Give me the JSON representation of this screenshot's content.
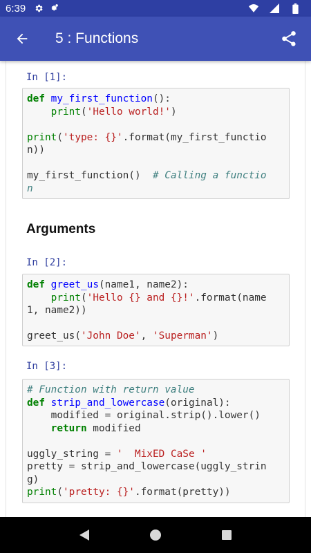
{
  "status_bar": {
    "time": "6:39",
    "icons": [
      "settings-icon",
      "settings-dot-icon",
      "wifi-icon",
      "signal-icon",
      "battery-icon"
    ]
  },
  "app_bar": {
    "title": "5 : Functions",
    "back_icon": "arrow-back-icon",
    "share_icon": "share-icon",
    "color": "#3f51b5",
    "status_color": "#2e3fa3"
  },
  "cells": [
    {
      "prompt": "In [1]:",
      "lines": [
        [
          [
            "kw",
            "def"
          ],
          [
            "t",
            " "
          ],
          [
            "fn",
            "my_first_function"
          ],
          [
            "t",
            "():"
          ]
        ],
        [
          [
            "t",
            "    "
          ],
          [
            "bi",
            "print"
          ],
          [
            "t",
            "("
          ],
          [
            "st",
            "'Hello world!'"
          ],
          [
            "t",
            ")"
          ]
        ],
        [
          [
            "t",
            ""
          ]
        ],
        [
          [
            "bi",
            "print"
          ],
          [
            "t",
            "("
          ],
          [
            "st",
            "'type: {}'"
          ],
          [
            "t",
            ".format(my_first_functio"
          ]
        ],
        [
          [
            "t",
            "n))"
          ]
        ],
        [
          [
            "t",
            ""
          ]
        ],
        [
          [
            "t",
            "my_first_function()  "
          ],
          [
            "cm",
            "# Calling a functio"
          ]
        ],
        [
          [
            "cm",
            "n"
          ]
        ]
      ]
    },
    {
      "prompt": "In [2]:",
      "lines": [
        [
          [
            "kw",
            "def"
          ],
          [
            "t",
            " "
          ],
          [
            "fn",
            "greet_us"
          ],
          [
            "t",
            "(name1, name2):"
          ]
        ],
        [
          [
            "t",
            "    "
          ],
          [
            "bi",
            "print"
          ],
          [
            "t",
            "("
          ],
          [
            "st",
            "'Hello {} and {}!'"
          ],
          [
            "t",
            ".format(name"
          ]
        ],
        [
          [
            "t",
            "1, name2))"
          ]
        ],
        [
          [
            "t",
            ""
          ]
        ],
        [
          [
            "t",
            "greet_us("
          ],
          [
            "st",
            "'John Doe'"
          ],
          [
            "t",
            ", "
          ],
          [
            "st",
            "'Superman'"
          ],
          [
            "t",
            ")"
          ]
        ]
      ]
    },
    {
      "prompt": "In [3]:",
      "lines": [
        [
          [
            "cm",
            "# Function with return value"
          ]
        ],
        [
          [
            "kw",
            "def"
          ],
          [
            "t",
            " "
          ],
          [
            "fn",
            "strip_and_lowercase"
          ],
          [
            "t",
            "(original):"
          ]
        ],
        [
          [
            "t",
            "    modified "
          ],
          [
            "op",
            "="
          ],
          [
            "t",
            " original.strip().lower()"
          ]
        ],
        [
          [
            "t",
            "    "
          ],
          [
            "kw",
            "return"
          ],
          [
            "t",
            " modified"
          ]
        ],
        [
          [
            "t",
            ""
          ]
        ],
        [
          [
            "t",
            "uggly_string "
          ],
          [
            "op",
            "="
          ],
          [
            "t",
            " "
          ],
          [
            "st",
            "'  MixED CaSe '"
          ]
        ],
        [
          [
            "t",
            "pretty "
          ],
          [
            "op",
            "="
          ],
          [
            "t",
            " strip_and_lowercase(uggly_strin"
          ]
        ],
        [
          [
            "t",
            "g)"
          ]
        ],
        [
          [
            "bi",
            "print"
          ],
          [
            "t",
            "("
          ],
          [
            "st",
            "'pretty: {}'"
          ],
          [
            "t",
            ".format(pretty))"
          ]
        ]
      ]
    }
  ],
  "section_heading": "Arguments",
  "nav_bar": {
    "back_icon": "nav-back-icon",
    "home_icon": "nav-home-icon",
    "recents_icon": "nav-recents-icon"
  }
}
